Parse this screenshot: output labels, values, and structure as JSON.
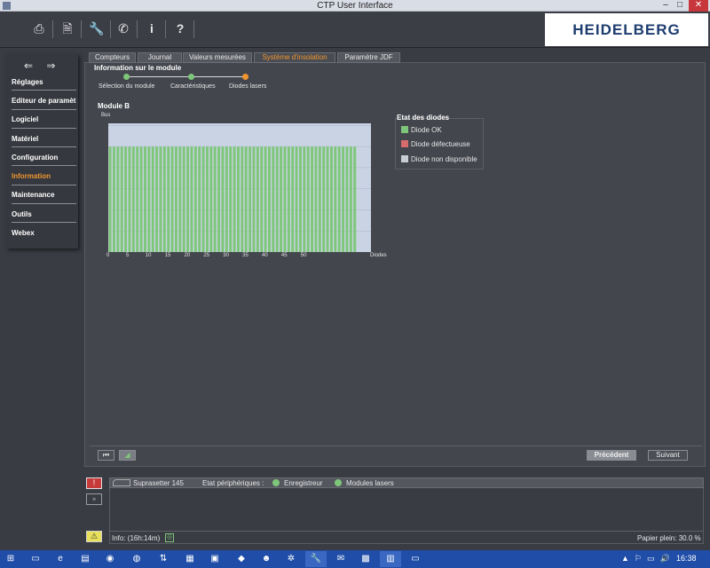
{
  "window": {
    "title": "CTP User Interface",
    "minimize": "–",
    "maximize": "□",
    "close": "✕"
  },
  "toolbar": {
    "buttons": [
      {
        "name": "printer-icon",
        "glyph": "⎙"
      },
      {
        "name": "document-ab-icon",
        "glyph": "🗎"
      },
      {
        "name": "wrench-icon",
        "glyph": "🔧"
      },
      {
        "name": "phone-icon",
        "glyph": "✆"
      },
      {
        "name": "info-icon",
        "glyph": "i"
      },
      {
        "name": "help-icon",
        "glyph": "?"
      }
    ],
    "logo": "HEIDELBERG"
  },
  "sidebar": {
    "arrows": [
      "⇐",
      "⇒"
    ],
    "items": [
      {
        "label": "Réglages"
      },
      {
        "label": "Editeur de paramètres"
      },
      {
        "label": "Logiciel"
      },
      {
        "label": "Matériel"
      },
      {
        "label": "Configuration"
      },
      {
        "label": "Information",
        "active": true
      },
      {
        "label": "Maintenance"
      },
      {
        "label": "Outils"
      },
      {
        "label": "Webex"
      }
    ]
  },
  "tabs": [
    {
      "label": "Compteurs"
    },
    {
      "label": "Journal"
    },
    {
      "label": "Valeurs mesurées"
    },
    {
      "label": "Système d'insolation",
      "active": true
    },
    {
      "label": "Paramètre JDF"
    }
  ],
  "module_info": {
    "heading": "Information sur le module",
    "steps": [
      {
        "label": "Sélection du module",
        "state": "done"
      },
      {
        "label": "Caractéristiques",
        "state": "done"
      },
      {
        "label": "Diodes lasers",
        "state": "current"
      }
    ],
    "module_title": "Module B"
  },
  "chart_data": {
    "type": "bar",
    "ylabel": "Bus",
    "xlabel": "Diodes",
    "x_ticks": [
      "0",
      "5",
      "10",
      "15",
      "20",
      "25",
      "30",
      "35",
      "40",
      "45",
      "50"
    ],
    "x_range": [
      0,
      64
    ],
    "bar_count": 64,
    "bar_value": 1,
    "ylim": [
      0,
      1.22
    ],
    "grid": true,
    "bar_color": "#7ec77a",
    "plot_bg": "#c9d3e3"
  },
  "legend": {
    "title": "Etat des diodes",
    "items": [
      {
        "label": "Diode OK",
        "color": "#7ec77a"
      },
      {
        "label": "Diode défectueuse",
        "color": "#d86b6b"
      },
      {
        "label": "Diode non disponible",
        "color": "#c8ccd4"
      }
    ]
  },
  "nav": {
    "previous": "Précédent",
    "next": "Suivant"
  },
  "status": {
    "device": "Suprasetter 145",
    "peripherals_label": "Etat périphériques :",
    "peripherals": [
      {
        "label": "Enregistreur",
        "color": "#7ec77a"
      },
      {
        "label": "Modules lasers",
        "color": "#7ec77a"
      }
    ],
    "info": "Info: (16h:14m)",
    "paper": "Papier plein: 30.0 %"
  },
  "taskbar": {
    "time": "16:38",
    "tray": [
      "▲",
      "⚐",
      "▭",
      "🔊"
    ]
  },
  "colors": {
    "accent": "#f0962e",
    "ok": "#7ec77a"
  }
}
